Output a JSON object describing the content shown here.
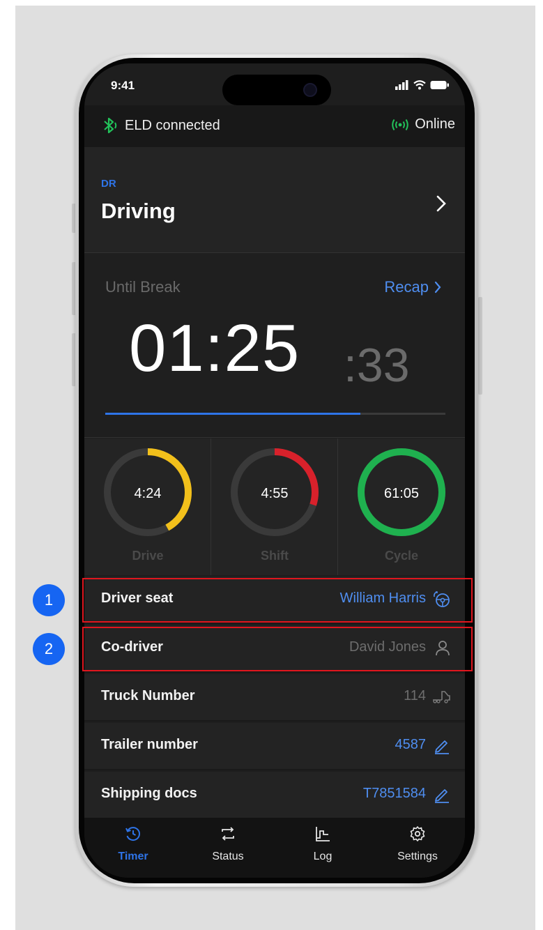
{
  "status_bar": {
    "time": "9:41"
  },
  "eld": {
    "label": "ELD connected",
    "online": "Online"
  },
  "status": {
    "code": "DR",
    "name": "Driving"
  },
  "timer": {
    "label": "Until Break",
    "recap": "Recap",
    "hours_minutes": "01:25",
    "seconds": ":33",
    "progress_fraction": 0.75
  },
  "dials": [
    {
      "value": "4:24",
      "label": "Drive",
      "color": "#f2c01b",
      "fraction": 0.42,
      "start": 0.0
    },
    {
      "value": "4:55",
      "label": "Shift",
      "color": "#d8212b",
      "fraction": 0.3,
      "start": 0.0
    },
    {
      "value": "61:05",
      "label": "Cycle",
      "color": "#1fb14f",
      "fraction": 1.0,
      "start": 0.0
    }
  ],
  "info_rows": [
    {
      "label": "Driver seat",
      "value": "William Harris",
      "value_style": "blue",
      "icon": "steering-wheel-icon"
    },
    {
      "label": "Co-driver",
      "value": "David Jones",
      "value_style": "grey",
      "icon": "person-icon"
    },
    {
      "label": "Truck Number",
      "value": "114",
      "value_style": "grey",
      "icon": "truck-icon"
    },
    {
      "label": "Trailer number",
      "value": "4587",
      "value_style": "blue",
      "icon": "pencil-icon"
    },
    {
      "label": "Shipping docs",
      "value": "T7851584",
      "value_style": "blue",
      "icon": "pencil-icon"
    }
  ],
  "tabs": [
    {
      "label": "Timer",
      "icon": "clock-icon",
      "active": true
    },
    {
      "label": "Status",
      "icon": "swap-icon",
      "active": false
    },
    {
      "label": "Log",
      "icon": "log-chart-icon",
      "active": false
    },
    {
      "label": "Settings",
      "icon": "gear-icon",
      "active": false
    }
  ],
  "callouts": [
    "1",
    "2"
  ],
  "colors": {
    "accent": "#2e74e8",
    "link": "#4f8ef0",
    "connected": "#22c25a",
    "callout_border": "#e0161e",
    "callout_badge": "#1665f2"
  }
}
